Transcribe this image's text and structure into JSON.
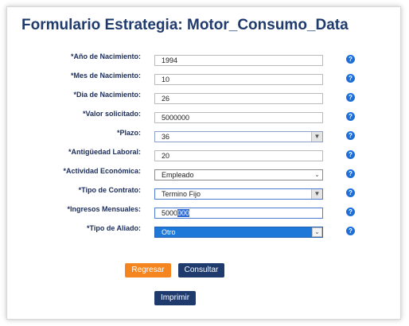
{
  "form": {
    "title": "Formulario Estrategia: Motor_Consumo_Data",
    "help_glyph": "?",
    "fields": {
      "anio": {
        "label": "*Año de Nacimiento:",
        "value": "1994"
      },
      "mes": {
        "label": "*Mes de Nacimiento:",
        "value": "10"
      },
      "dia": {
        "label": "*Dia de Nacimiento:",
        "value": "26"
      },
      "valor": {
        "label": "*Valor solicitado:",
        "value": "5000000"
      },
      "plazo": {
        "label": "*Plazo:",
        "value": "36"
      },
      "antiguedad": {
        "label": "*Antigüedad Laboral:",
        "value": "20"
      },
      "actividad": {
        "label": "*Actividad Económica:",
        "value": "Empleado"
      },
      "contrato": {
        "label": "*Tipo de Contrato:",
        "value": "Termino Fijo"
      },
      "ingresos": {
        "label": "*Ingresos Mensuales:",
        "value_plain": "5000",
        "value_selected": "000"
      },
      "aliado": {
        "label": "*Tipo de Aliado:",
        "value": "Otro"
      }
    }
  },
  "buttons": {
    "regresar": "Regresar",
    "consultar": "Consultar",
    "imprimir": "Imprimir"
  },
  "colors": {
    "title": "#1f3b6d",
    "label": "#1a2c5b",
    "help_icon": "#1e6fd9",
    "orange_button": "#f5861f",
    "navy_button": "#1f3b6d",
    "selected_option": "#1e78d7"
  }
}
